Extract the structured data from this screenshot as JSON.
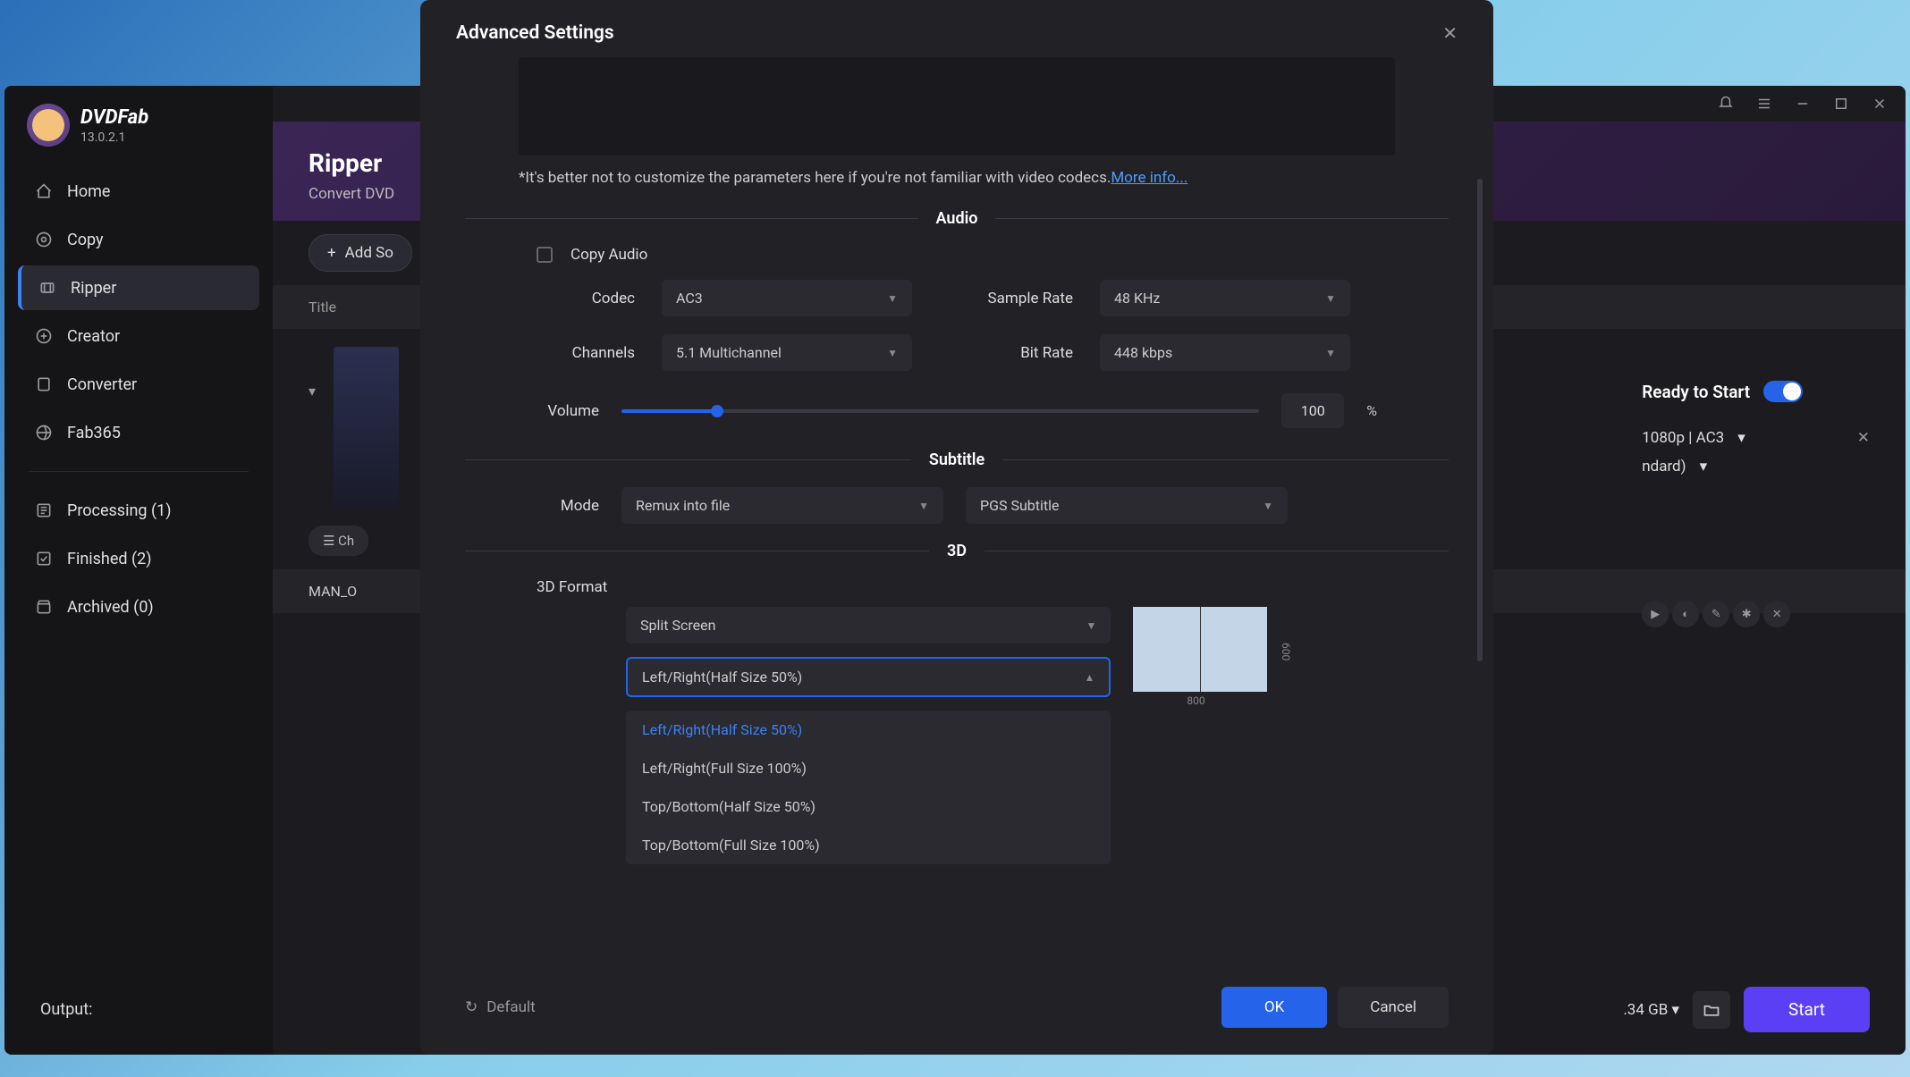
{
  "app": {
    "name": "DVDFab",
    "version": "13.0.2.1"
  },
  "sidebar": {
    "items": [
      {
        "label": "Home"
      },
      {
        "label": "Copy"
      },
      {
        "label": "Ripper"
      },
      {
        "label": "Creator"
      },
      {
        "label": "Converter"
      },
      {
        "label": "Fab365"
      }
    ],
    "status": [
      {
        "label": "Processing (1)"
      },
      {
        "label": "Finished (2)"
      },
      {
        "label": "Archived (0)"
      }
    ]
  },
  "content": {
    "title": "Ripper",
    "subtitle": "Convert DVD",
    "addSource": "Add So",
    "tableHeader": "Title",
    "chooseBtn": "Ch",
    "fileRow": "MAN_O",
    "readyText": "Ready to Start",
    "format": "1080p | AC3",
    "quality": "ndard)",
    "output": "Output:",
    "size": ".34 GB",
    "startBtn": "Start"
  },
  "modal": {
    "title": "Advanced Settings",
    "info": "*It's better not to customize the parameters here if you're not familiar with video codecs.",
    "infoLink": "More info...",
    "sections": {
      "audio": "Audio",
      "subtitle": "Subtitle",
      "threed": "3D"
    },
    "audio": {
      "copyAudio": "Copy Audio",
      "codecLabel": "Codec",
      "codecValue": "AC3",
      "sampleRateLabel": "Sample Rate",
      "sampleRateValue": "48 KHz",
      "channelsLabel": "Channels",
      "channelsValue": "5.1 Multichannel",
      "bitRateLabel": "Bit Rate",
      "bitRateValue": "448 kbps",
      "volumeLabel": "Volume",
      "volumeValue": "100",
      "percent": "%"
    },
    "subtitle": {
      "modeLabel": "Mode",
      "modeValue": "Remux into file",
      "typeValue": "PGS Subtitle"
    },
    "threed": {
      "formatLabel": "3D Format",
      "splitScreen": "Split Screen",
      "selected": "Left/Right(Half Size 50%)",
      "options": [
        "Left/Right(Half Size 50%)",
        "Left/Right(Full Size 100%)",
        "Top/Bottom(Half Size 50%)",
        "Top/Bottom(Full Size 100%)"
      ],
      "width": "800",
      "height": "600"
    },
    "footer": {
      "default": "Default",
      "ok": "OK",
      "cancel": "Cancel"
    }
  }
}
